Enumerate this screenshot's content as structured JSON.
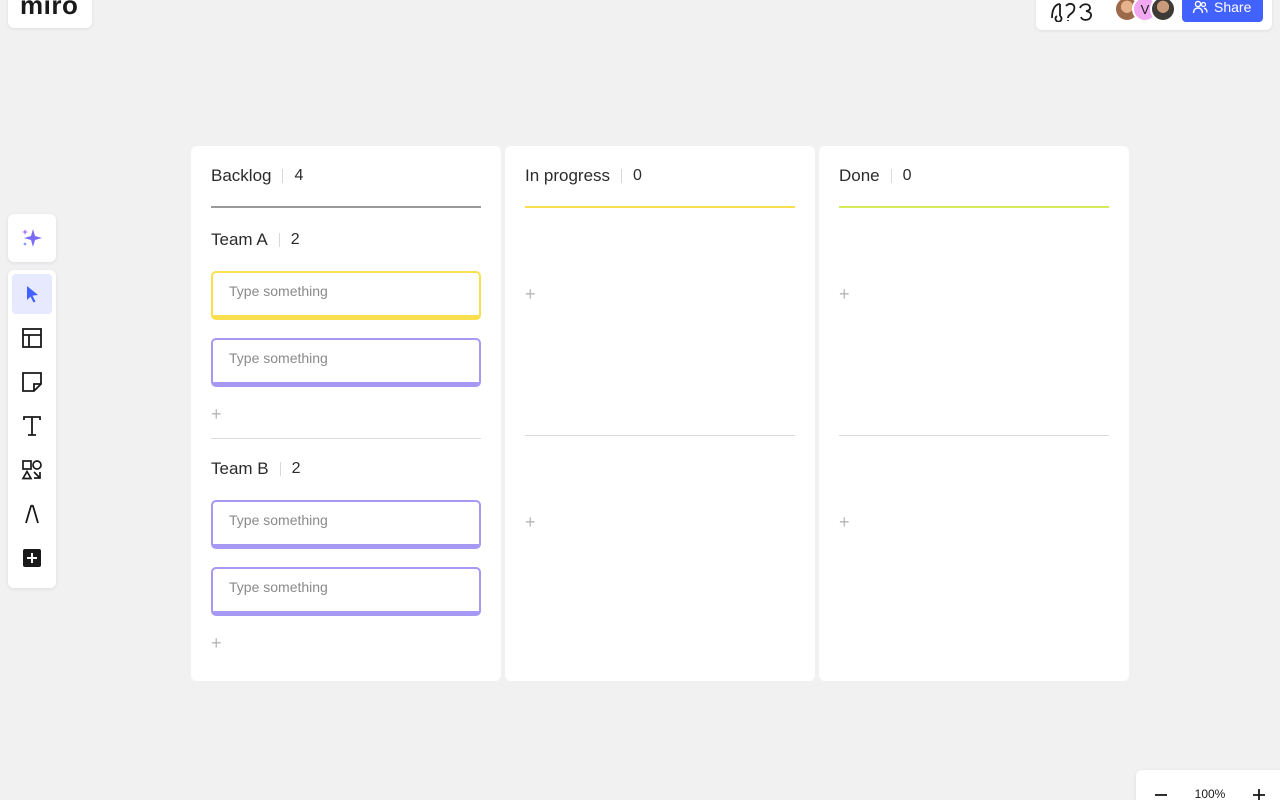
{
  "app": {
    "logo": "miro"
  },
  "topbar": {
    "avatars": [
      {
        "initial": ""
      },
      {
        "initial": "V"
      },
      {
        "initial": ""
      }
    ],
    "share_label": "Share"
  },
  "colors": {
    "accent": "#4262ff",
    "yellow": "#f9df4d",
    "purple": "#a699f4",
    "lime": "#d6ea5a",
    "gray_line": "#9a9a9a"
  },
  "board": {
    "columns": [
      {
        "title": "Backlog",
        "count": "4",
        "groups": [
          {
            "title": "Team A",
            "count": "2",
            "cards": [
              "Type something",
              "Type something"
            ]
          },
          {
            "title": "Team B",
            "count": "2",
            "cards": [
              "Type something",
              "Type something"
            ]
          }
        ]
      },
      {
        "title": "In progress",
        "count": "0"
      },
      {
        "title": "Done",
        "count": "0"
      }
    ],
    "add_symbol": "+"
  },
  "toolbar": {
    "icons": [
      "sparkle-ai-icon",
      "cursor-select-icon",
      "templates-icon",
      "sticky-note-icon",
      "text-icon",
      "shapes-icon",
      "pen-icon",
      "add-more-icon"
    ]
  },
  "zoom": {
    "level": "100%"
  }
}
